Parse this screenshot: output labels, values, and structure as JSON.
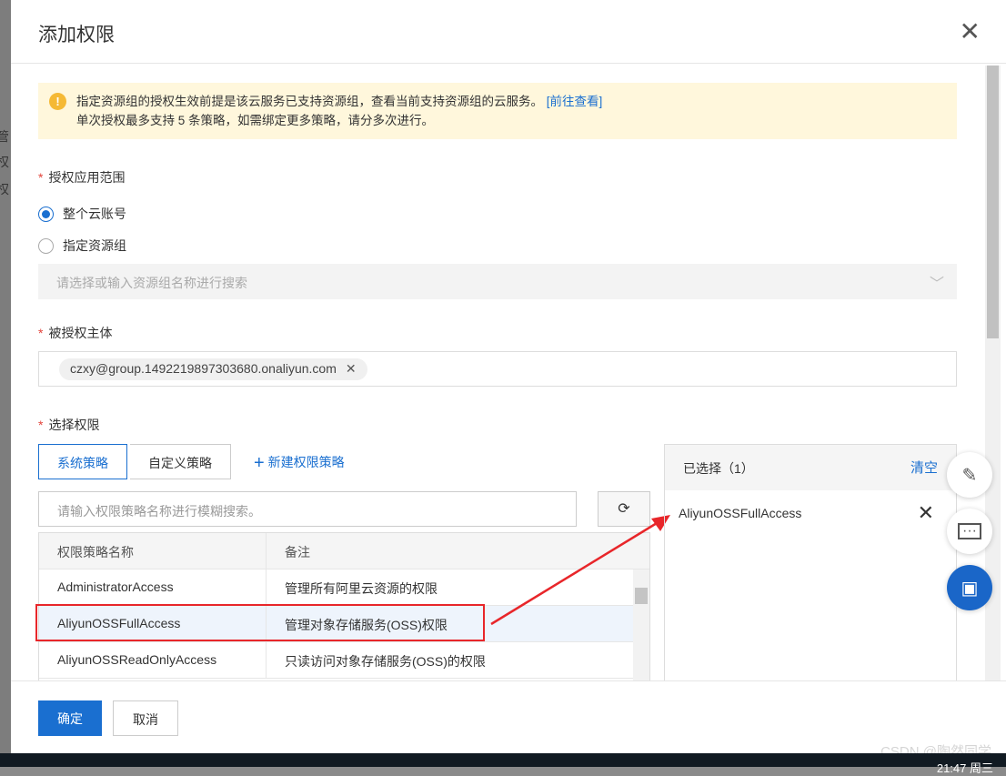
{
  "background": {
    "fragments": [
      "管",
      "权",
      "权"
    ]
  },
  "dialog": {
    "title": "添加权限",
    "alert": {
      "line1": "指定资源组的授权生效前提是该云服务已支持资源组，查看当前支持资源组的云服务。",
      "link": "[前往查看]",
      "line2": "单次授权最多支持 5 条策略，如需绑定更多策略，请分多次进行。"
    },
    "scope": {
      "label": "授权应用范围",
      "options": [
        {
          "label": "整个云账号",
          "selected": true
        },
        {
          "label": "指定资源组",
          "selected": false
        }
      ],
      "select_placeholder": "请选择或输入资源组名称进行搜索"
    },
    "principal": {
      "label": "被授权主体",
      "tag": "czxy@group.1492219897303680.onaliyun.com"
    },
    "permissions": {
      "label": "选择权限",
      "tabs": [
        "系统策略",
        "自定义策略"
      ],
      "new_policy": "新建权限策略",
      "search_placeholder": "请输入权限策略名称进行模糊搜索。",
      "columns": [
        "权限策略名称",
        "备注"
      ],
      "rows": [
        {
          "name": "AdministratorAccess",
          "note": "管理所有阿里云资源的权限"
        },
        {
          "name": "AliyunOSSFullAccess",
          "note": "管理对象存储服务(OSS)权限"
        },
        {
          "name": "AliyunOSSReadOnlyAccess",
          "note": "只读访问对象存储服务(OSS)的权限"
        }
      ],
      "selected": {
        "title": "已选择（1）",
        "clear": "清空",
        "items": [
          "AliyunOSSFullAccess"
        ]
      }
    },
    "footer": {
      "ok": "确定",
      "cancel": "取消"
    }
  },
  "taskbar": {
    "clock": "21:47 周三"
  },
  "watermark": "CSDN @陶然同学",
  "colors": {
    "primary": "#1a6fd0",
    "highlight": "#e8262a",
    "alert_bg": "#fff7dc"
  }
}
